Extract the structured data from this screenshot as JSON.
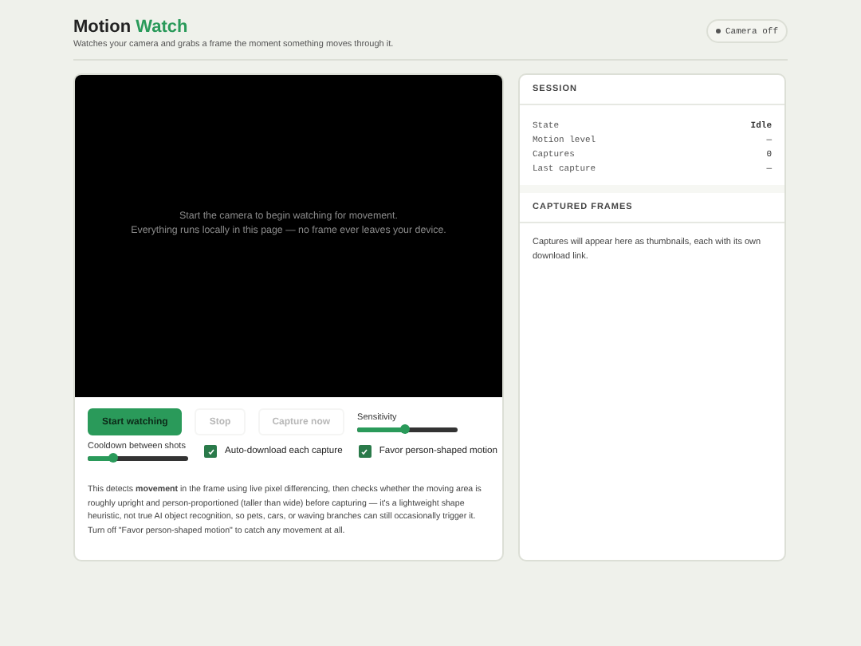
{
  "header": {
    "title": "Motion ",
    "title_accent": "Watch",
    "subtitle": "Watches your camera and grabs a frame the moment something moves through it.",
    "status": {
      "label": "Camera off",
      "on": false
    }
  },
  "viewer": {
    "message": [
      "Start the camera to begin watching for movement.",
      "Everything runs locally in this page — no frame ever leaves your device."
    ]
  },
  "controls": {
    "buttons": [
      {
        "label": "Start watching",
        "kind": "primary",
        "disabled": false
      },
      {
        "label": "Stop",
        "kind": "secondary",
        "disabled": true
      },
      {
        "label": "Capture now",
        "kind": "secondary",
        "disabled": true
      }
    ],
    "sliders": [
      {
        "label": "Sensitivity",
        "level": 0.47
      },
      {
        "label": "Cooldown between shots",
        "level": 0.25
      }
    ],
    "checkboxes": [
      {
        "label": "Auto-download each capture",
        "checked": true
      },
      {
        "label": "Favor person-shaped motion",
        "checked": true
      }
    ]
  },
  "note": "This detects **movement** in the frame using live pixel differencing, then checks whether the moving area is roughly upright and person-proportioned (taller than wide) before capturing — it's a lightweight shape heuristic, not true AI object recognition, so pets, cars, or waving branches can still occasionally trigger it. Turn off \"Favor person-shaped motion\" to catch any movement at all.",
  "session": {
    "title": "SESSION",
    "rows": [
      {
        "label": "State",
        "value": "Idle",
        "bold": true
      },
      {
        "label": "Motion level",
        "value": "—",
        "bold": false
      },
      {
        "label": "Captures",
        "value": "0",
        "bold": false
      },
      {
        "label": "Last capture",
        "value": "—",
        "bold": false
      }
    ]
  },
  "frames": {
    "title": "CAPTURED FRAMES",
    "empty": "Captures will appear here as thumbnails, each with its own download link."
  }
}
